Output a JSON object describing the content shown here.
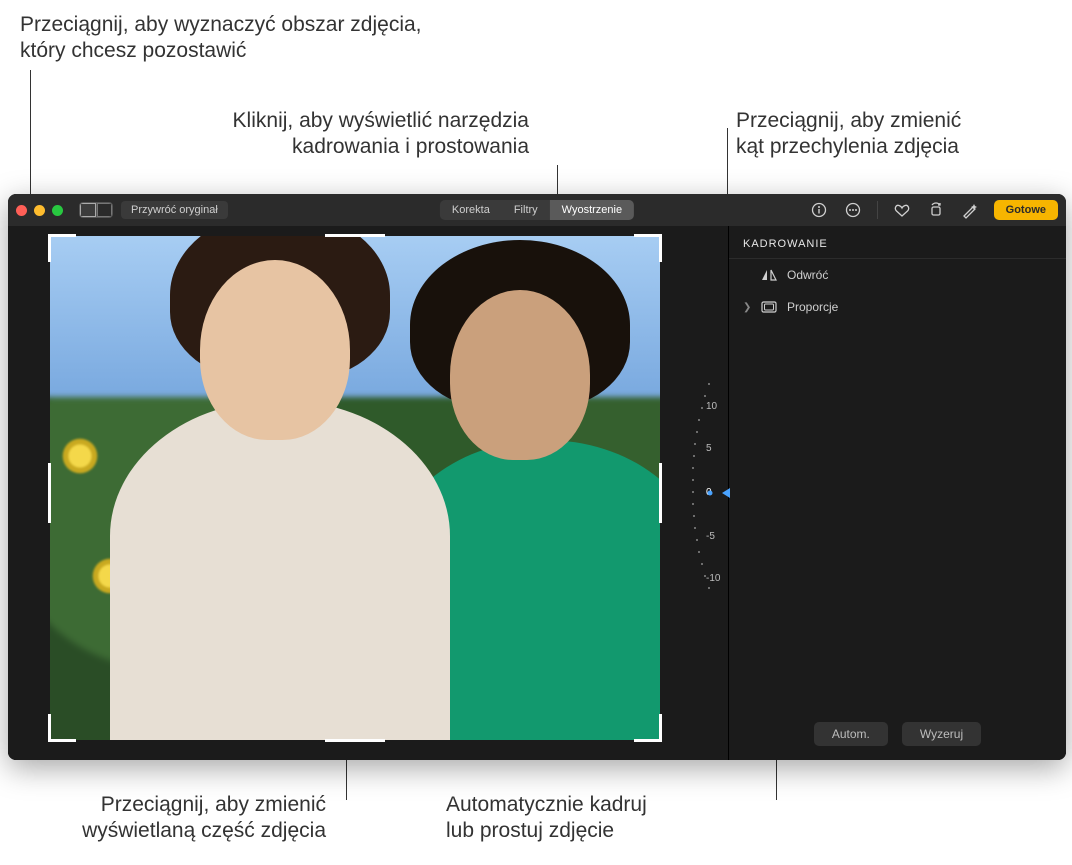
{
  "callouts": {
    "crop_drag": "Przeciągnij, aby wyznaczyć obszar zdjęcia,\nktóry chcesz pozostawić",
    "tools_click": "Kliknij, aby wyświetlić narzędzia\nkadrowania i prostowania",
    "tilt_drag": "Przeciągnij, aby zmienić\nkąt przechylenia zdjęcia",
    "view_drag": "Przeciągnij, aby zmienić\nwyświetlaną część zdjęcia",
    "auto_crop": "Automatycznie kadruj\nlub prostuj zdjęcie"
  },
  "toolbar": {
    "revert": "Przywróć oryginał",
    "seg_adjust": "Korekta",
    "seg_filters": "Filtry",
    "seg_crop": "Wyostrzenie",
    "done": "Gotowe"
  },
  "dial": {
    "center": "0",
    "minus5": "-5",
    "minus10": "-10",
    "plus5": "5",
    "plus10": "10"
  },
  "panel": {
    "header": "KADROWANIE",
    "flip": "Odwróć",
    "aspect": "Proporcje"
  },
  "footer": {
    "auto": "Autom.",
    "reset": "Wyzeruj"
  }
}
